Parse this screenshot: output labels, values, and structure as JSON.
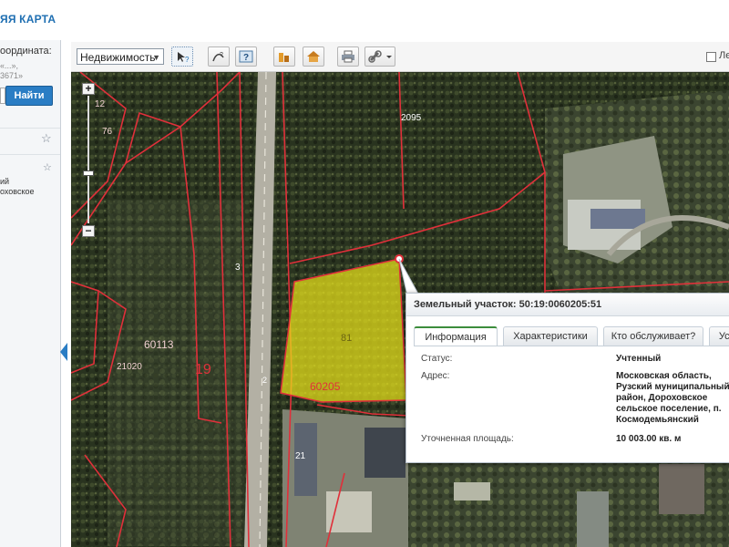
{
  "app": {
    "title": "ЯЯ КАРТА"
  },
  "left_panel": {
    "coord_label": "оордината:",
    "hint_line1": "«...»,",
    "hint_line2": "3671»",
    "find_button": "Найти",
    "result_address": [
      "ий",
      "оховское"
    ]
  },
  "toolbar": {
    "layer_select_value": "Недвижимость",
    "checkbox_label": "Ле"
  },
  "map": {
    "parcel_labels": [
      "2095",
      "60113",
      "21020",
      "19",
      "81",
      "60205",
      "3",
      "2",
      "21",
      "76",
      "12"
    ]
  },
  "popup": {
    "title": "Земельный участок: 50:19:0060205:51",
    "tabs": [
      "Информация",
      "Характеристики",
      "Кто обслуживает?",
      "Усл"
    ],
    "rows": [
      {
        "key": "Статус:",
        "value": [
          "Учтенный"
        ]
      },
      {
        "key": "Адрес:",
        "value": [
          "Московская область,",
          "Рузский муниципальный",
          "район, Дороховское",
          "сельское поселение, п.",
          "Космодемьянский"
        ]
      },
      {
        "key": "Уточненная площадь:",
        "value": [
          "10 003.00 кв. м"
        ]
      }
    ]
  },
  "colors": {
    "accent": "#2a7dc4",
    "parcel_fill": "#e9e21a",
    "parcel_border": "#e0303a"
  }
}
